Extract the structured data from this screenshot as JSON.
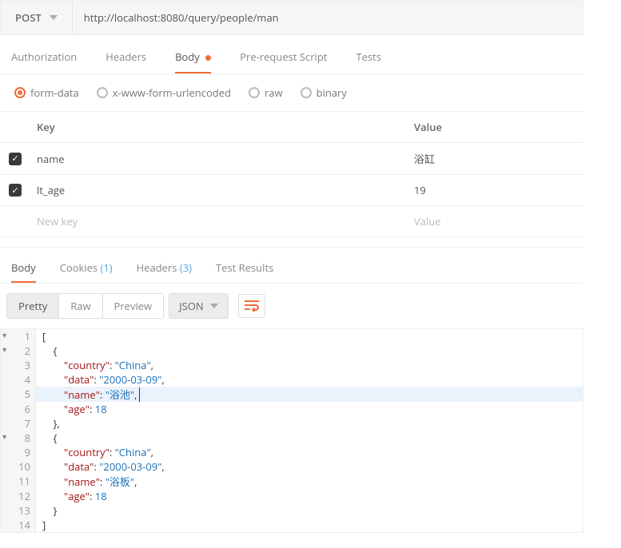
{
  "request": {
    "method": "POST",
    "url": "http://localhost:8080/query/people/man"
  },
  "reqTabs": {
    "authorization": "Authorization",
    "headers": "Headers",
    "body": "Body",
    "prerequest": "Pre-request Script",
    "tests": "Tests"
  },
  "bodyTypes": {
    "formdata": "form-data",
    "xwww": "x-www-form-urlencoded",
    "raw": "raw",
    "binary": "binary"
  },
  "kv": {
    "headKey": "Key",
    "headVal": "Value",
    "rows": [
      {
        "key": "name",
        "value": "浴缸"
      },
      {
        "key": "lt_age",
        "value": "19"
      }
    ],
    "placeholderKey": "New key",
    "placeholderVal": "Value"
  },
  "respTabs": {
    "body": "Body",
    "cookies": "Cookies",
    "cookiesCount": "(1)",
    "headers": "Headers",
    "headersCount": "(3)",
    "tests": "Test Results"
  },
  "respTools": {
    "pretty": "Pretty",
    "raw": "Raw",
    "preview": "Preview",
    "format": "JSON"
  },
  "code": {
    "lines": [
      {
        "n": "1",
        "fold": true,
        "text": "["
      },
      {
        "n": "2",
        "fold": true,
        "text": "    {"
      },
      {
        "n": "3",
        "text": "        \"country\": \"China\","
      },
      {
        "n": "4",
        "text": "        \"data\": \"2000-03-09\","
      },
      {
        "n": "5",
        "hl": true,
        "text": "        \"name\": \"浴池\","
      },
      {
        "n": "6",
        "text": "        \"age\": 18"
      },
      {
        "n": "7",
        "text": "    },"
      },
      {
        "n": "8",
        "fold": true,
        "text": "    {"
      },
      {
        "n": "9",
        "text": "        \"country\": \"China\","
      },
      {
        "n": "10",
        "text": "        \"data\": \"2000-03-09\","
      },
      {
        "n": "11",
        "text": "        \"name\": \"浴板\","
      },
      {
        "n": "12",
        "text": "        \"age\": 18"
      },
      {
        "n": "13",
        "text": "    }"
      },
      {
        "n": "14",
        "text": "]"
      }
    ]
  }
}
